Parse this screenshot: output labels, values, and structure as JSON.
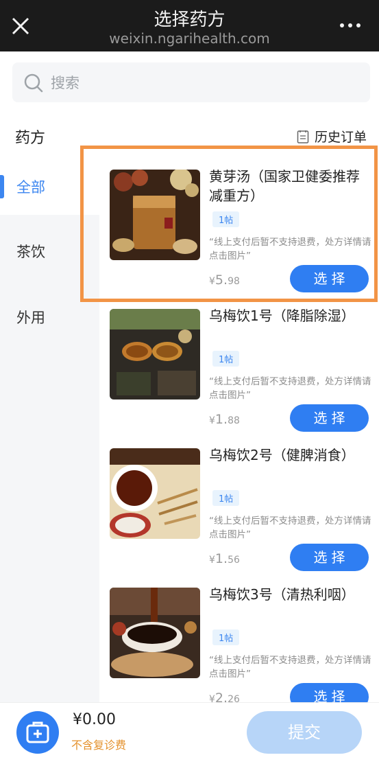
{
  "topbar": {
    "title": "选择药方",
    "subtitle": "weixin.ngarihealth.com"
  },
  "search": {
    "placeholder": "搜索"
  },
  "section": {
    "title": "药方",
    "history_label": "历史订单"
  },
  "sidebar": {
    "items": [
      {
        "label": "全部",
        "active": true
      },
      {
        "label": "茶饮",
        "active": false
      },
      {
        "label": "外用",
        "active": false
      }
    ]
  },
  "products": [
    {
      "title": "黄芽汤（国家卫健委推荐减重方）",
      "tag": "1帖",
      "note": "“线上支付后暂不支持退费，处方详情请点击图片”",
      "currency": "¥",
      "price_int": "5.",
      "price_dec": "98",
      "button": "选择"
    },
    {
      "title": "乌梅饮1号（降脂除湿）",
      "tag": "1帖",
      "note": "“线上支付后暂不支持退费，处方详情请点击图片”",
      "currency": "¥",
      "price_int": "1.",
      "price_dec": "88",
      "button": "选择"
    },
    {
      "title": "乌梅饮2号（健脾消食）",
      "tag": "1帖",
      "note": "“线上支付后暂不支持退费，处方详情请点击图片”",
      "currency": "¥",
      "price_int": "1.",
      "price_dec": "56",
      "button": "选择"
    },
    {
      "title": "乌梅饮3号（清热利咽）",
      "tag": "1帖",
      "note": "“线上支付后暂不支持退费，处方详情请点击图片”",
      "currency": "¥",
      "price_int": "2.",
      "price_dec": "26",
      "button": "选择"
    }
  ],
  "bottom": {
    "total": "¥0.00",
    "note": "不含复诊费",
    "submit": "提交"
  },
  "colors": {
    "accent": "#2f7ef2",
    "highlight": "#f29446",
    "note_orange": "#e4912c"
  }
}
